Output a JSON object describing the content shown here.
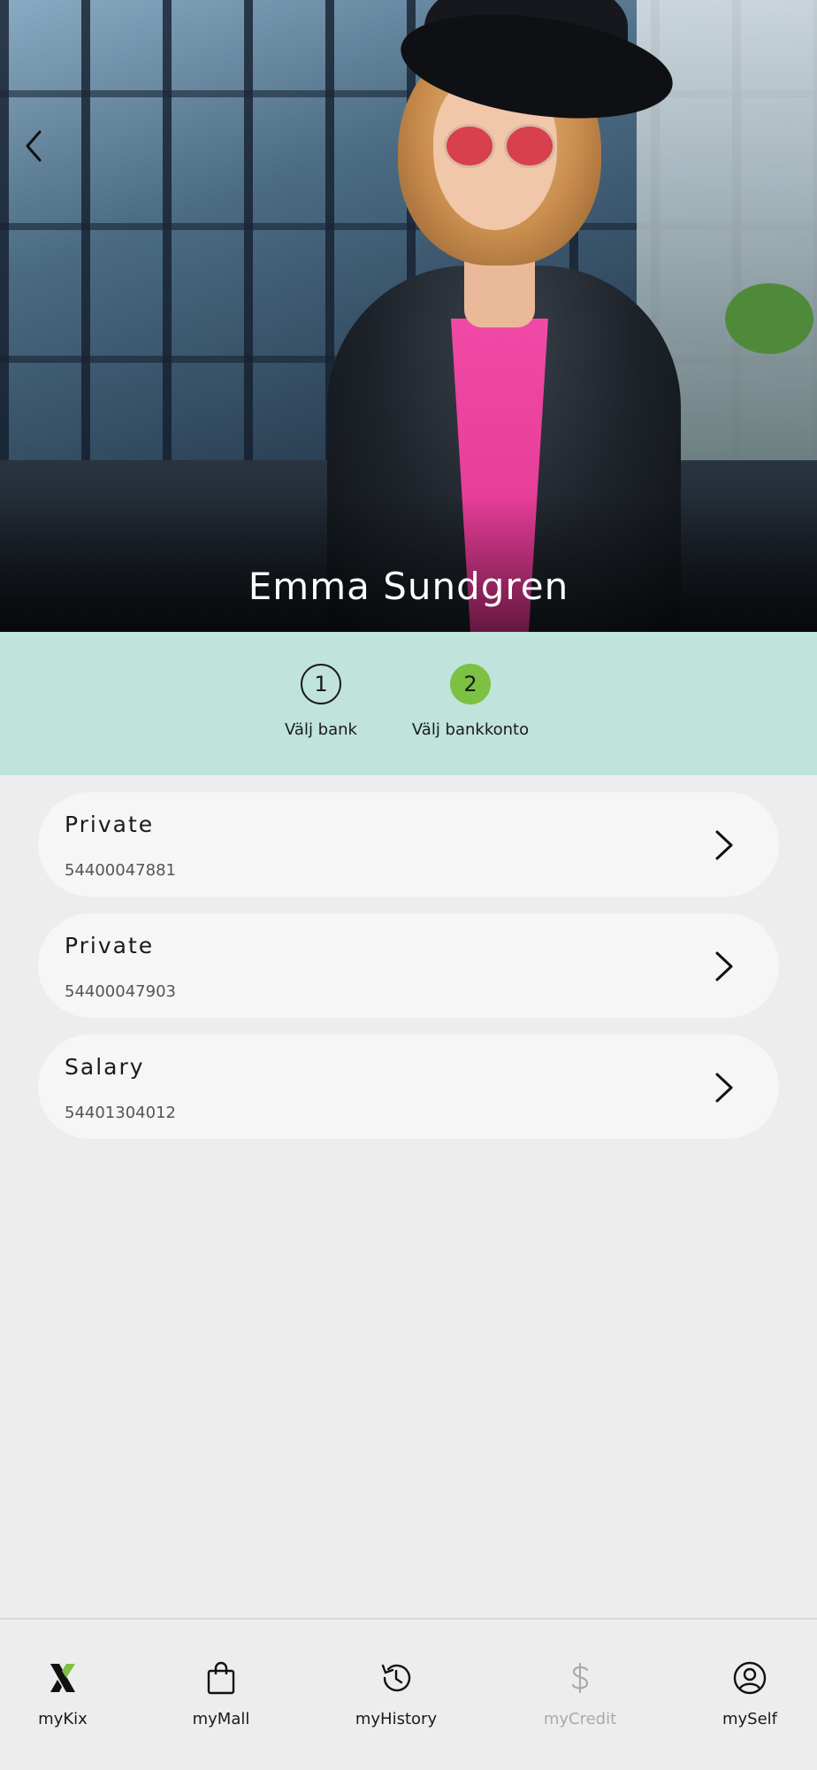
{
  "header": {
    "name": "Emma Sundgren"
  },
  "stepper": {
    "steps": [
      {
        "number": "1",
        "label": "Välj bank"
      },
      {
        "number": "2",
        "label": "Välj bankkonto"
      }
    ],
    "active_color": "#7cc142",
    "background_color": "#c0e3dc"
  },
  "accounts": [
    {
      "name": "Private",
      "number": "54400047881"
    },
    {
      "name": "Private",
      "number": "54400047903"
    },
    {
      "name": "Salary",
      "number": "54401304012"
    }
  ],
  "bottom_nav": {
    "items": [
      {
        "label": "myKix",
        "icon": "kix-logo-icon"
      },
      {
        "label": "myMall",
        "icon": "shopping-bag-icon"
      },
      {
        "label": "myHistory",
        "icon": "history-icon"
      },
      {
        "label": "myCredit",
        "icon": "dollar-icon",
        "disabled": true
      },
      {
        "label": "mySelf",
        "icon": "user-circle-icon"
      }
    ]
  }
}
